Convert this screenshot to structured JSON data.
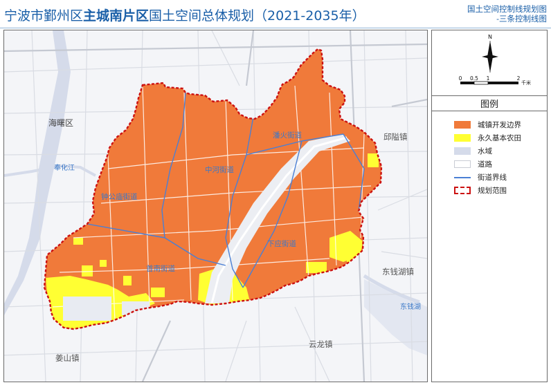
{
  "title": {
    "prefix": "宁波市鄞州区",
    "emphasis": "主城南片区",
    "suffix": "国土空间总体规划（2021-2035年）"
  },
  "subtitle": {
    "line1": "国土空间控制线规划图",
    "line2": "-三条控制线图"
  },
  "scale_bar": {
    "ticks": [
      "0",
      "0.5",
      "1",
      "2"
    ],
    "unit": "千米"
  },
  "compass": {
    "north_label": "N"
  },
  "legend": {
    "title": "图例",
    "items": [
      {
        "label": "城镇开发边界",
        "color": "#f07a3a"
      },
      {
        "label": "永久基本农田",
        "color": "#ffff33"
      },
      {
        "label": "水域",
        "color": "#d5dbea"
      },
      {
        "label": "道路",
        "color": "#ffffff"
      },
      {
        "label": "街道界线",
        "color": "#4a7fd4"
      },
      {
        "label": "规划范围",
        "color": "#cc1111"
      }
    ]
  },
  "map_labels": {
    "haishu": "海曙区",
    "fenghua_river": "奉化江",
    "zhonghe": "钟公庙街道",
    "zhonghe_st": "中河街道",
    "panhuo": "潘火街道",
    "xiaying": "下应街道",
    "shounan": "首南街道",
    "qiuai": "邱隘镇",
    "dongqianhu": "东钱湖镇",
    "dongqian_lake": "东钱湖",
    "yunlong": "云龙镇",
    "jiangshan": "姜山镇"
  },
  "colors": {
    "development": "#f07a3a",
    "farmland": "#ffff33",
    "water": "#d5dbea",
    "road": "#ffffff",
    "street_boundary": "#4a7fd4",
    "plan_boundary": "#cc1111",
    "label_blue": "#3a78c8"
  }
}
